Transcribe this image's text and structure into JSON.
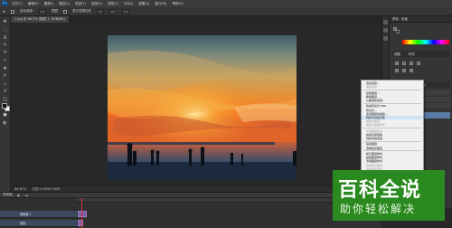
{
  "menubar": {
    "logo": "Ps",
    "items": [
      "文件(F)",
      "编辑(E)",
      "图像(I)",
      "图层(L)",
      "类型(Y)",
      "选择(S)",
      "滤镜(T)",
      "3D(D)",
      "视图(V)",
      "窗口(W)",
      "帮助(H)"
    ]
  },
  "options": {
    "items": [
      "自动选择:",
      "图层",
      "显示变换控件"
    ]
  },
  "document": {
    "tab_label": "1.jpg @ 66.7% (图层 1, RGB/8#)"
  },
  "right_panel": {
    "tabs": [
      "颜色",
      "色板"
    ],
    "adjust_tabs": [
      "调整",
      "样式"
    ],
    "layers_tabs": [
      "图层",
      "通道",
      "路径"
    ]
  },
  "context_menu": {
    "items": [
      {
        "label": "混合选项...",
        "disabled": false
      },
      {
        "label": "编辑调整...",
        "disabled": true
      },
      {
        "label": "复制图层...",
        "disabled": false
      },
      {
        "label": "删除图层",
        "disabled": false
      },
      {
        "label": "从图层新建组...",
        "disabled": false
      },
      {
        "label": "快速导出为 PNG",
        "disabled": false
      },
      {
        "label": "导出为...",
        "disabled": false
      },
      {
        "label": "来自图层的画板...",
        "disabled": false
      },
      {
        "label": "转换为智能对象",
        "disabled": false
      },
      {
        "label": "栅格化图层",
        "disabled": true
      },
      {
        "label": "栅格化图层样式",
        "disabled": true
      },
      {
        "label": "停用图层蒙版",
        "disabled": true
      },
      {
        "label": "启用矢量蒙版",
        "disabled": false
      },
      {
        "label": "创建剪贴蒙版",
        "disabled": false
      },
      {
        "label": "链接图层",
        "disabled": false
      },
      {
        "label": "选择链接图层",
        "disabled": false
      },
      {
        "label": "拷贝图层样式",
        "disabled": false
      },
      {
        "label": "粘贴图层样式",
        "disabled": false
      },
      {
        "label": "清除图层样式",
        "disabled": false
      },
      {
        "label": "复制形状属性",
        "disabled": true
      },
      {
        "label": "粘贴形状属性",
        "disabled": true
      },
      {
        "label": "从隔离图层释放",
        "disabled": true
      },
      {
        "label": "合并图层",
        "disabled": false
      },
      {
        "label": "合并可见图层",
        "disabled": false
      }
    ]
  },
  "status": {
    "zoom": "66.67%",
    "doc_size": "文档:3.00M/3.00M"
  },
  "timeline": {
    "title": "时间轴",
    "tracks": [
      "视频组 1",
      "音轨"
    ]
  },
  "watermark": {
    "title": "百科全说",
    "subtitle": "助你轻松解决"
  }
}
